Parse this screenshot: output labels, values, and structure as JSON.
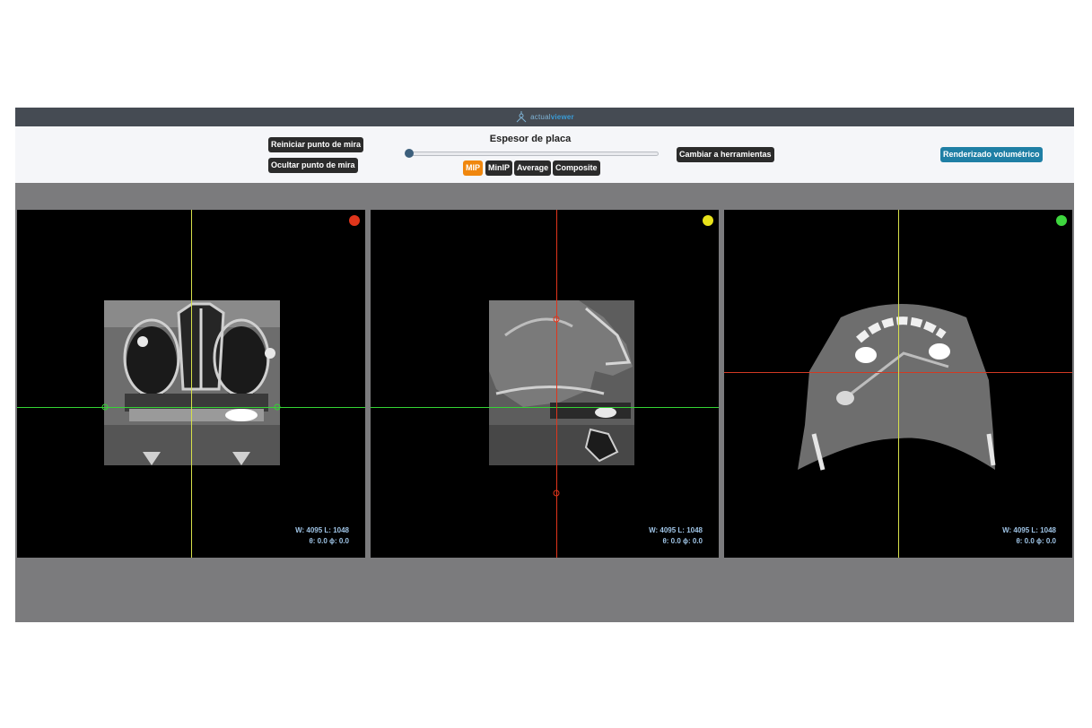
{
  "app": {
    "logo_text_a": "actual",
    "logo_text_b": "viewer"
  },
  "toolbar": {
    "reset_crosshair": "Reiniciar punto de mira",
    "hide_crosshair": "Ocultar punto de mira",
    "slab_thickness_title": "Espesor de placa",
    "slab_thickness_value": 0,
    "blend_modes": [
      "MIP",
      "MinIP",
      "Average",
      "Composite"
    ],
    "active_blend_mode": "MIP",
    "switch_tools": "Cambiar a herramientas",
    "volume_render": "Renderizado volumétrico"
  },
  "viewports": [
    {
      "id": "coronal",
      "dot_color": "#e0351b",
      "wl": "W: 4095 L: 1048",
      "angles": "θ: 0.0 ϕ: 0.0",
      "h_line_color": "#34d434",
      "v_line_color": "#d7e04a"
    },
    {
      "id": "sagittal",
      "dot_color": "#e8e21a",
      "wl": "W: 4095 L: 1048",
      "angles": "θ: 0.0 ϕ: 0.0",
      "h_line_color": "#34d434",
      "v_line_color": "#e0351b"
    },
    {
      "id": "axial",
      "dot_color": "#3ed63e",
      "wl": "W: 4095 L: 1048",
      "angles": "θ: 0.0 ϕ: 0.0",
      "h_line_color": "#d23a23",
      "v_line_color": "#d7e04a"
    }
  ],
  "colors": {
    "accent_orange": "#f0870e",
    "button_dark": "#2b2b2b",
    "button_blue": "#1f7fa5",
    "app_background": "#7b7b7d",
    "topbar": "#454b53"
  }
}
